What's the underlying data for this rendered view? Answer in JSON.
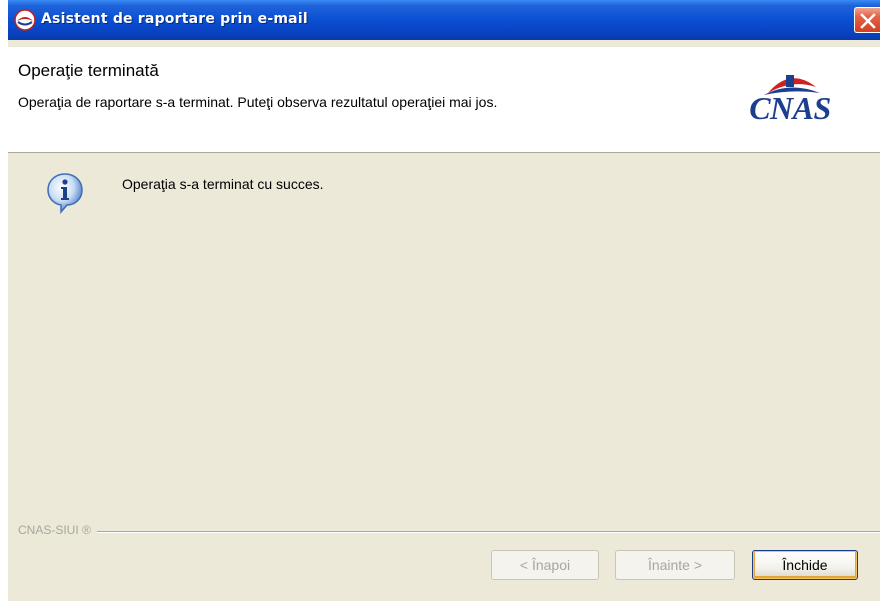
{
  "window": {
    "title": "Asistent de raportare prin e-mail",
    "title_icon": "cnas-app-icon",
    "close_icon": "close-icon"
  },
  "header": {
    "title": "Operaţie terminată",
    "subtitle": "Operaţia de raportare s-a terminat. Puteţi observa rezultatul operaţiei mai jos.",
    "logo_text": "CNAS"
  },
  "body": {
    "icon": "info-icon",
    "message": "Operaţia s-a terminat cu succes."
  },
  "footer": {
    "brand": "CNAS-SIUI ®",
    "back_label": "< Înapoi",
    "next_label": "Înainte >",
    "close_label": "Închide"
  },
  "colors": {
    "titlebar": "#0A4FD2",
    "dialog_background": "#ECE9D8",
    "logo_blue": "#1B3E8F",
    "logo_red": "#D21F1F"
  }
}
